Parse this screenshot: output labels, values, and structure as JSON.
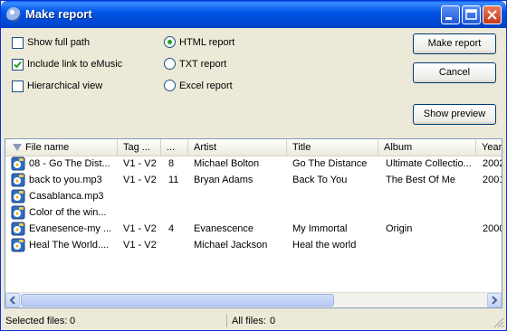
{
  "window": {
    "title": "Make report"
  },
  "options": {
    "show_full_path": {
      "label": "Show full path",
      "checked": false
    },
    "include_link": {
      "label": "Include link to eMusic",
      "checked": true
    },
    "hierarchical": {
      "label": "Hierarchical view",
      "checked": false
    }
  },
  "formats": {
    "html": {
      "label": "HTML report",
      "selected": true
    },
    "txt": {
      "label": "TXT report",
      "selected": false
    },
    "excel": {
      "label": "Excel report",
      "selected": false
    }
  },
  "buttons": {
    "make_report": "Make report",
    "cancel": "Cancel",
    "show_preview": "Show preview"
  },
  "table": {
    "columns": [
      "File name",
      "Tag ...",
      "...",
      "Artist",
      "Title",
      "Album",
      "Year"
    ],
    "rows": [
      [
        "08 - Go The Dist...",
        "V1 - V2",
        "8",
        "Michael Bolton",
        "Go The Distance",
        "Ultimate Collectio...",
        "2002"
      ],
      [
        "back to you.mp3",
        "V1 - V2",
        "11",
        "Bryan Adams",
        "Back To You",
        "The Best Of Me",
        "2001"
      ],
      [
        "Casablanca.mp3",
        "",
        "",
        "",
        "",
        "",
        ""
      ],
      [
        "Color of the win...",
        "",
        "",
        "",
        "",
        "",
        ""
      ],
      [
        "Evanesence-my ...",
        "V1 - V2",
        "4",
        "Evanescence",
        "My Immortal",
        "Origin",
        "2000"
      ],
      [
        "Heal The World....",
        "V1 - V2",
        "",
        "Michael Jackson",
        "Heal the world",
        "",
        ""
      ]
    ]
  },
  "status": {
    "selected_label": "Selected files:",
    "selected_count": "0",
    "all_label": "All files:",
    "all_count": "0"
  }
}
